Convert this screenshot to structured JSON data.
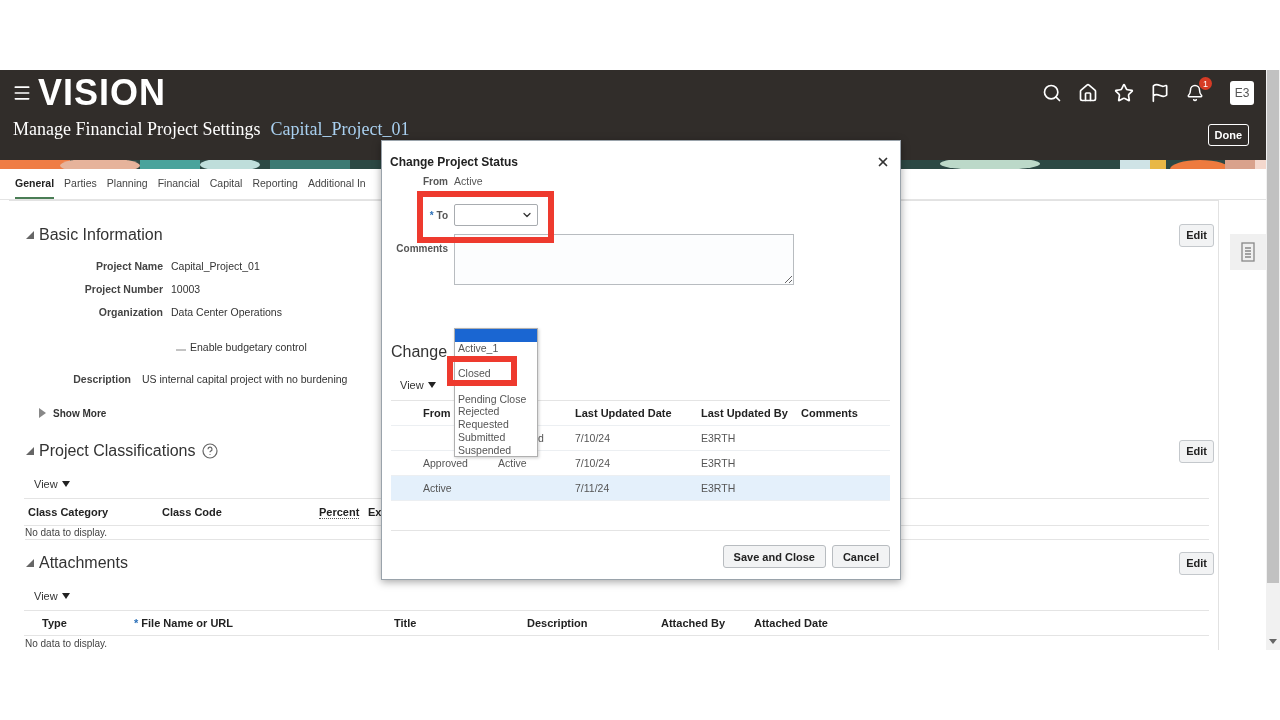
{
  "header": {
    "logo": "VISION",
    "notification_count": "1",
    "avatar": "E3",
    "title": "Manage Financial Project Settings",
    "project_link": "Capital_Project_01",
    "done": "Done"
  },
  "tabs": [
    {
      "label": "General",
      "selected": true
    },
    {
      "label": "Parties",
      "selected": false
    },
    {
      "label": "Planning",
      "selected": false
    },
    {
      "label": "Financial",
      "selected": false
    },
    {
      "label": "Capital",
      "selected": false
    },
    {
      "label": "Reporting",
      "selected": false
    },
    {
      "label": "Additional In",
      "selected": false
    }
  ],
  "basic_information": {
    "title": "Basic Information",
    "expanded": true,
    "edit": "Edit",
    "fields": [
      {
        "label": "Project Name",
        "value": "Capital_Project_01"
      },
      {
        "label": "Project Number",
        "value": "10003"
      },
      {
        "label": "Organization",
        "value": "Data Center Operations"
      }
    ],
    "budgetary_control": {
      "label": "Enable budgetary control",
      "checked": false
    },
    "description": {
      "label": "Description",
      "value": "US internal capital project with no burdening"
    },
    "show_more": {
      "label": "Show More",
      "expanded": false
    }
  },
  "project_classifications": {
    "title": "Project Classifications",
    "expanded": true,
    "edit": "Edit",
    "view": "View",
    "columns": [
      {
        "label": "Class Category",
        "underlined": false
      },
      {
        "label": "Class Code",
        "underlined": false
      },
      {
        "label": "Percent",
        "underlined": true
      },
      {
        "label": "Ex",
        "underlined": false
      }
    ],
    "empty": "No data to display."
  },
  "attachments": {
    "title": "Attachments",
    "expanded": true,
    "edit": "Edit",
    "view": "View",
    "columns": [
      {
        "label": "Type"
      },
      {
        "label": "File Name or URL",
        "marker": "*"
      },
      {
        "label": "Title"
      },
      {
        "label": "Description"
      },
      {
        "label": "Attached By"
      },
      {
        "label": "Attached Date"
      }
    ],
    "empty": "No data to display."
  },
  "dialog": {
    "title": "Change Project Status",
    "from_label": "From",
    "from_value": "Active",
    "to_label": "To",
    "to_marker": "*",
    "comments_label": "Comments",
    "history_title": "Change",
    "view": "View",
    "columns": [
      "From",
      "Last Updated Date",
      "Last Updated By",
      "Comments"
    ],
    "rows": [
      {
        "to": "d",
        "date": "7/10/24",
        "by": "E3RTH",
        "selected": false,
        "to_cut": true
      },
      {
        "from": "Approved",
        "to": "Active",
        "date": "7/10/24",
        "by": "E3RTH",
        "selected": false,
        "to_cut": false
      },
      {
        "from": "Active",
        "date": "7/11/24",
        "by": "E3RTH",
        "selected": true
      }
    ],
    "buttons": [
      "Save and Close",
      "Cancel"
    ],
    "options": [
      {
        "selected": true
      },
      {
        "label": "Active_1",
        "selected": false
      },
      {
        "selected": false
      },
      {
        "label": "Closed",
        "selected": false
      },
      {
        "selected": false
      },
      {
        "label": "Pending Close",
        "selected": false
      },
      {
        "label": "Rejected",
        "selected": false
      },
      {
        "label": "Requested",
        "selected": false
      },
      {
        "label": "Submitted",
        "selected": false
      },
      {
        "label": "Suspended",
        "selected": false
      }
    ]
  },
  "callouts": [
    {
      "kind": "box"
    },
    {
      "kind": "box"
    }
  ]
}
